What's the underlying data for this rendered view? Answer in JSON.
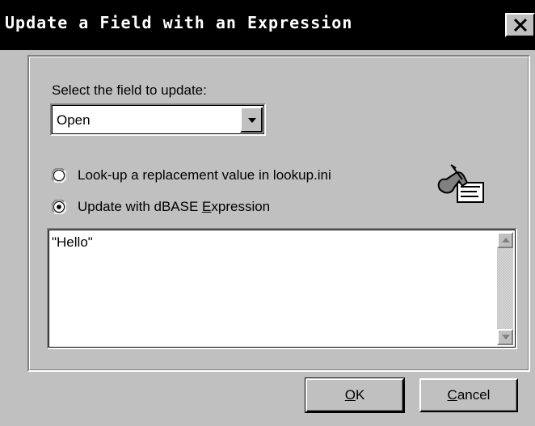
{
  "window": {
    "title": "Update a Field with an Expression",
    "close_glyph": "X"
  },
  "field_select": {
    "label": "Select the field to update:",
    "value": "Open"
  },
  "options": {
    "lookup": {
      "label": "Look-up a replacement value in lookup.ini",
      "selected": false
    },
    "expression": {
      "label_pre": "Update with dBASE ",
      "label_accel": "E",
      "label_post": "xpression",
      "selected": true
    },
    "icon": "clipboard-pointer-icon"
  },
  "expression_text": "\"Hello\"",
  "buttons": {
    "ok_accel": "O",
    "ok_rest": "K",
    "cancel_accel": "C",
    "cancel_rest": "ancel"
  },
  "colors": {
    "face": "#c0c0c0",
    "titlebar": "#000000",
    "title_text": "#ffffff"
  }
}
